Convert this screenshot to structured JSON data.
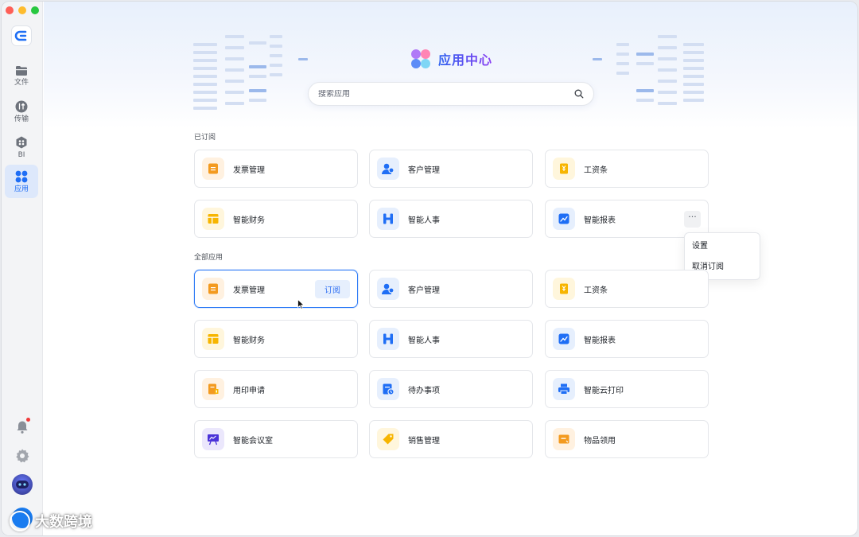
{
  "sidebar": {
    "items": [
      {
        "label": "文件"
      },
      {
        "label": "传输"
      },
      {
        "label": "BI"
      },
      {
        "label": "应用"
      }
    ]
  },
  "header": {
    "title": "应用中心"
  },
  "search": {
    "placeholder": "搜索应用"
  },
  "subscribed": {
    "title": "已订阅",
    "cards": [
      {
        "label": "发票管理",
        "icon": "invoice-icon"
      },
      {
        "label": "客户管理",
        "icon": "customer-icon"
      },
      {
        "label": "工资条",
        "icon": "payslip-icon"
      },
      {
        "label": "智能财务",
        "icon": "finance-icon"
      },
      {
        "label": "智能人事",
        "icon": "hr-icon"
      },
      {
        "label": "智能报表",
        "icon": "report-icon"
      }
    ],
    "more_label": "···",
    "menu": [
      "设置",
      "取消订阅"
    ]
  },
  "all": {
    "title": "全部应用",
    "subscribe_label": "订阅",
    "cards": [
      {
        "label": "发票管理",
        "icon": "invoice-icon"
      },
      {
        "label": "客户管理",
        "icon": "customer-icon"
      },
      {
        "label": "工资条",
        "icon": "payslip-icon"
      },
      {
        "label": "智能财务",
        "icon": "finance-icon"
      },
      {
        "label": "智能人事",
        "icon": "hr-icon"
      },
      {
        "label": "智能报表",
        "icon": "report-icon"
      },
      {
        "label": "用印申请",
        "icon": "seal-icon"
      },
      {
        "label": "待办事项",
        "icon": "todo-icon"
      },
      {
        "label": "智能云打印",
        "icon": "printer-icon"
      },
      {
        "label": "智能会议室",
        "icon": "meeting-icon"
      },
      {
        "label": "销售管理",
        "icon": "sales-tag-icon"
      },
      {
        "label": "物品领用",
        "icon": "goods-icon"
      }
    ]
  },
  "watermark": {
    "text": "大数跨境"
  },
  "colors": {
    "accent": "#2f6ff3",
    "orange": "#f39a1f",
    "blue": "#1f6ef5",
    "yellow": "#f7b500",
    "purple": "#5b3ee6"
  }
}
